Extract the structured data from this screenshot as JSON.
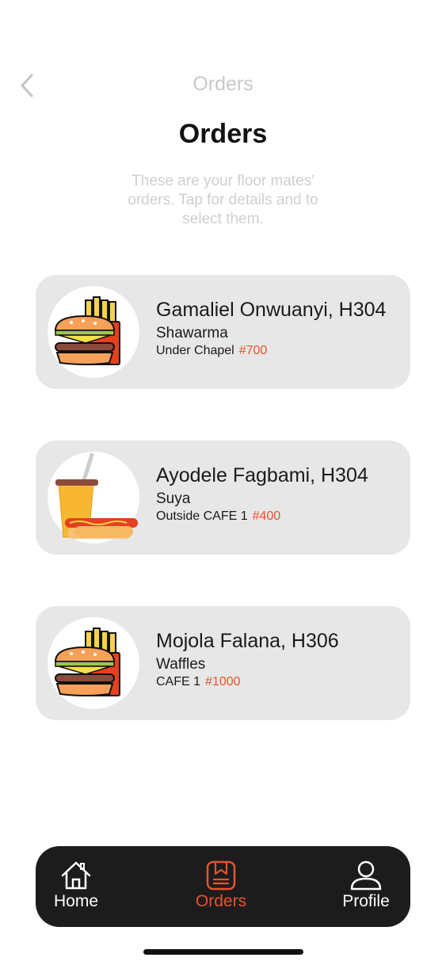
{
  "header": {
    "nav_title": "Orders",
    "page_title": "Orders",
    "subtitle": "These are your floor mates' orders. Tap for details and to select them."
  },
  "orders": [
    {
      "name": "Gamaliel Onwuanyi, H304",
      "item": "Shawarma",
      "location": "Under Chapel",
      "price": "#700",
      "icon": "burger-fries-icon"
    },
    {
      "name": "Ayodele Fagbami, H304",
      "item": "Suya",
      "location": "Outside CAFE 1",
      "price": "#400",
      "icon": "drink-hotdog-icon"
    },
    {
      "name": "Mojola Falana, H306",
      "item": "Waffles",
      "location": "CAFE 1",
      "price": "#1000",
      "icon": "burger-fries-icon"
    }
  ],
  "tabs": [
    {
      "label": "Home",
      "icon": "home-icon",
      "active": false
    },
    {
      "label": "Orders",
      "icon": "orders-bookmark-icon",
      "active": true
    },
    {
      "label": "Profile",
      "icon": "profile-icon",
      "active": false
    }
  ],
  "colors": {
    "accent": "#e8532a",
    "card_bg": "#e6e7e6",
    "tab_bar_bg": "#1c1c1c"
  }
}
